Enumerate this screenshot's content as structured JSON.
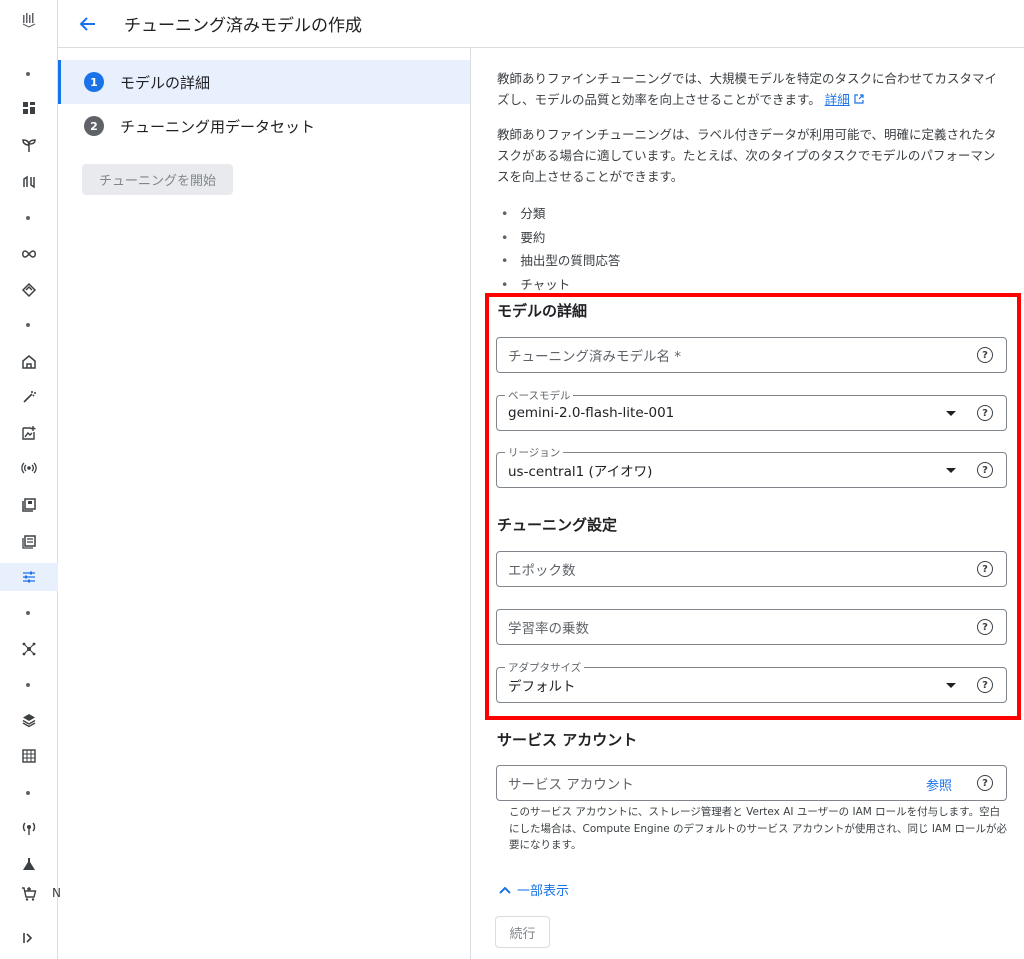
{
  "header": {
    "title": "チューニング済みモデルの作成"
  },
  "stepper": {
    "steps": [
      {
        "number": "1",
        "label": "モデルの詳細"
      },
      {
        "number": "2",
        "label": "チューニング用データセット"
      }
    ],
    "start_button": "チューニングを開始"
  },
  "intro": {
    "paragraph1": "教師ありファインチューニングでは、大規模モデルを特定のタスクに合わせてカスタマイズし、モデルの品質と効率を向上させることができます。",
    "details_link": "詳細",
    "paragraph2": "教師ありファインチューニングは、ラベル付きデータが利用可能で、明確に定義されたタスクがある場合に適しています。たとえば、次のタイプのタスクでモデルのパフォーマンスを向上させることができます。",
    "tasks": [
      "分類",
      "要約",
      "抽出型の質問応答",
      "チャット"
    ]
  },
  "model_details": {
    "title": "モデルの詳細",
    "tuned_model_name": {
      "placeholder": "チューニング済みモデル名 *",
      "value": ""
    },
    "base_model": {
      "label": "ベースモデル",
      "value": "gemini-2.0-flash-lite-001"
    },
    "region": {
      "label": "リージョン",
      "value": "us-central1 (アイオワ)"
    }
  },
  "tuning_settings": {
    "title": "チューニング設定",
    "epochs": {
      "placeholder": "エポック数"
    },
    "learning_rate": {
      "placeholder": "学習率の乗数"
    },
    "adapter_size": {
      "label": "アダプタサイズ",
      "value": "デフォルト"
    }
  },
  "service_account": {
    "title": "サービス アカウント",
    "placeholder": "サービス アカウント",
    "browse_link": "参照",
    "hint": "このサービス アカウントに、ストレージ管理者と Vertex AI ユーザーの IAM ロールを付与します。空白にした場合は、Compute Engine のデフォルトのサービス アカウントが使用され、同じ IAM ロールが必要になります。"
  },
  "show_less": "一部表示",
  "continue_button": "続行",
  "rail": {
    "peek_letter": "N"
  },
  "colors": {
    "accent": "#1a73e8",
    "highlight": "#ff0000"
  }
}
